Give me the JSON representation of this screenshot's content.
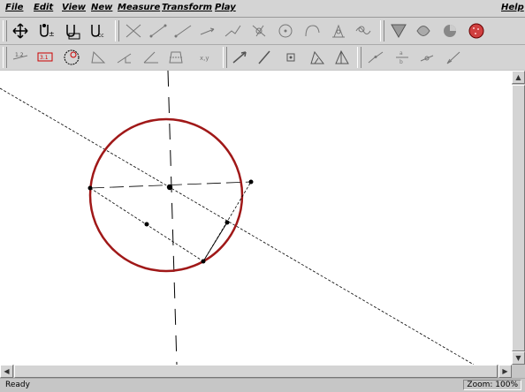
{
  "menu": {
    "file": "File",
    "edit": "Edit",
    "view": "View",
    "new": "New",
    "measure": "Measure",
    "transform": "Transform",
    "play": "Play",
    "help": "Help"
  },
  "status": {
    "text": "Ready",
    "zoom": "Zoom: 100%"
  },
  "colors": {
    "circle": "#a01818",
    "panel": "#d4d4d4",
    "fill_tool": "#d04040"
  },
  "toolbar_icons": [
    "move-icon",
    "point-icon",
    "midpoint-icon",
    "intersection-icon",
    "line-icon",
    "segment-icon",
    "ray-icon",
    "vector-icon",
    "polygon-icon",
    "perpendicular-icon",
    "circle-icon",
    "arc-icon",
    "compass-icon",
    "locus-icon",
    "fill-tool-icon",
    "hatch-tool-icon",
    "color-icon",
    "color-fill-icon",
    "distance-icon",
    "length-icon",
    "angle-measure-icon",
    "area-icon",
    "slope-icon",
    "angle-icon",
    "coordinates-icon",
    "equation-icon",
    "translate-icon",
    "reflect-icon",
    "rotate-icon",
    "dilate-icon",
    "perp-bisector-icon",
    "parallel-icon",
    "scale-icon",
    "bisect-icon",
    "vector-transform-icon",
    "dilate-ratio-icon",
    "rotate-point-icon"
  ]
}
